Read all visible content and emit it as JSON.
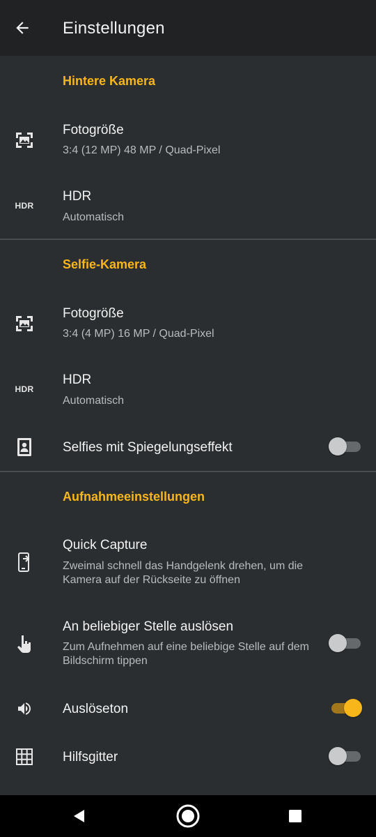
{
  "header": {
    "title": "Einstellungen",
    "back_icon": "arrow-back-icon"
  },
  "sections": {
    "rear": {
      "title": "Hintere Kamera",
      "photo_size": {
        "title": "Fotogröße",
        "value": "3:4 (12 MP) 48 MP / Quad-Pixel",
        "icon": "photo-size-icon"
      },
      "hdr": {
        "title": "HDR",
        "value": "Automatisch",
        "icon_label": "HDR"
      }
    },
    "selfie": {
      "title": "Selfie-Kamera",
      "photo_size": {
        "title": "Fotogröße",
        "value": "3:4 (4 MP) 16 MP / Quad-Pixel",
        "icon": "photo-size-icon"
      },
      "hdr": {
        "title": "HDR",
        "value": "Automatisch",
        "icon_label": "HDR"
      },
      "mirror": {
        "title": "Selfies mit Spiegelungseffekt",
        "enabled": false,
        "icon": "portrait-icon"
      }
    },
    "capture": {
      "title": "Aufnahmeeinstellungen",
      "quick_capture": {
        "title": "Quick Capture",
        "description": "Zweimal schnell das Handgelenk drehen, um die Kamera auf der Rückseite zu öffnen",
        "icon": "phone-rotate-icon"
      },
      "tap_anywhere": {
        "title": "An beliebiger Stelle auslösen",
        "description": "Zum Aufnehmen auf eine beliebige Stelle auf dem Bildschirm tippen",
        "enabled": false,
        "icon": "touch-icon"
      },
      "shutter_sound": {
        "title": "Auslöseton",
        "enabled": true,
        "icon": "volume-icon"
      },
      "grid": {
        "title": "Hilfsgitter",
        "enabled": false,
        "icon": "grid-icon"
      }
    }
  },
  "navbar": {
    "back": "nav-back-icon",
    "home": "nav-home-icon",
    "recents": "nav-recents-icon"
  },
  "colors": {
    "accent": "#f9b61b",
    "background": "#2b2e30",
    "appbar": "#202224",
    "toggle_off": "#66696b"
  }
}
